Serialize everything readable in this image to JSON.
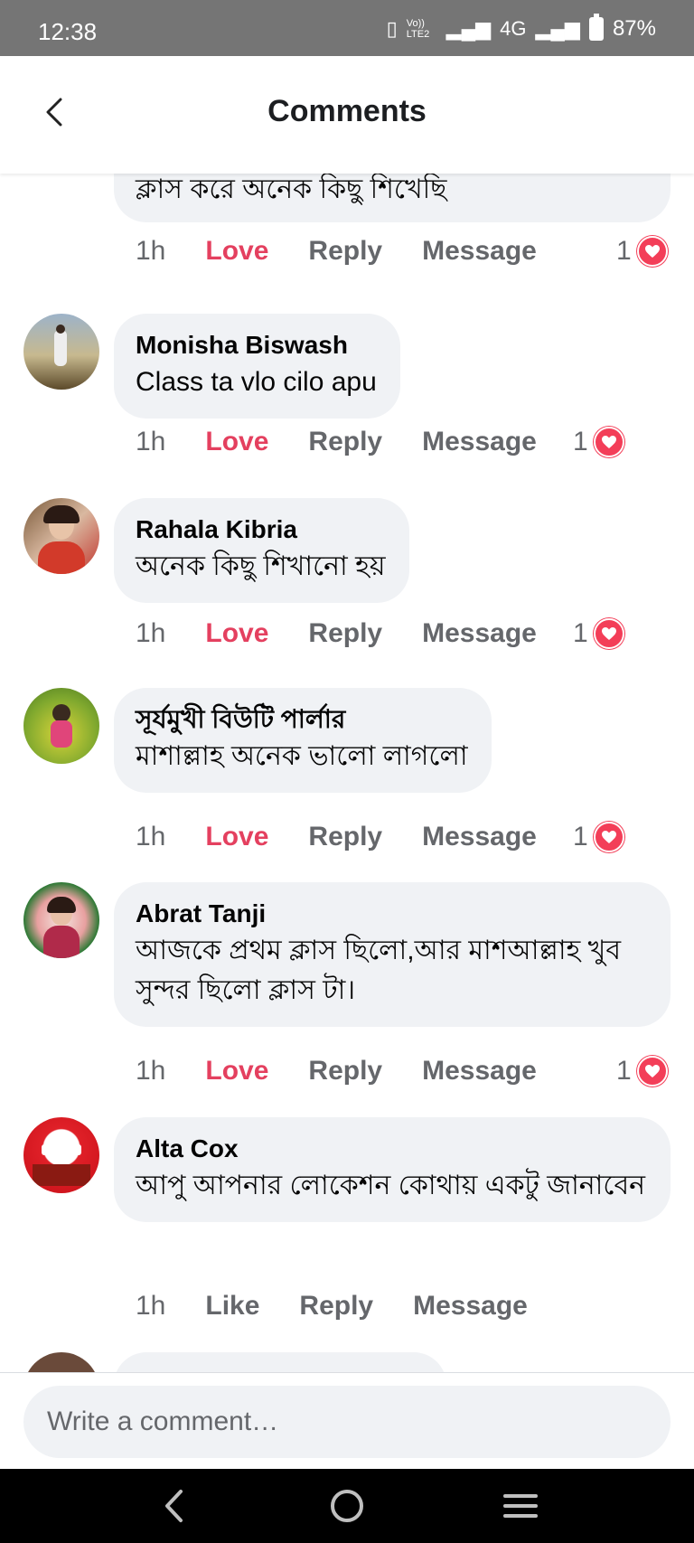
{
  "status": {
    "time": "12:38",
    "network_vol": "Vo)) LTE2",
    "network_type": "4G",
    "battery": "87%"
  },
  "header": {
    "title": "Comments",
    "back_icon": "chevron-left-icon"
  },
  "partial_comment": {
    "text": "ক্লাস করে অনেক কিছু শিখেছি",
    "time": "1h",
    "like_label": "Love",
    "reply_label": "Reply",
    "message_label": "Message",
    "reaction_count": "1"
  },
  "comments": [
    {
      "name": "Monisha Biswash",
      "text": "Class ta vlo cilo apu",
      "time": "1h",
      "like_label": "Love",
      "reply_label": "Reply",
      "message_label": "Message",
      "reaction_count": "1"
    },
    {
      "name": "Rahala Kibria",
      "text": "অনেক কিছু শিখানো হয়",
      "time": "1h",
      "like_label": "Love",
      "reply_label": "Reply",
      "message_label": "Message",
      "reaction_count": "1"
    },
    {
      "name": "সূর্যমুখী বিউটি পার্লার",
      "text": "মাশাল্লাহ  অনেক ভালো লাগলো",
      "time": "1h",
      "like_label": "Love",
      "reply_label": "Reply",
      "message_label": "Message",
      "reaction_count": "1"
    },
    {
      "name": "Abrat Tanji",
      "text": "আজকে প্রথম ক্লাস ছিলো,আর মাশআল্লাহ খুব সুন্দর ছিলো ক্লাস টা।",
      "time": "1h",
      "like_label": "Love",
      "reply_label": "Reply",
      "message_label": "Message",
      "reaction_count": "1"
    },
    {
      "name": "Alta Cox",
      "text": "আপু আপনার লোকেশন কোথায় একটু জানাবেন",
      "time": "1h",
      "like_label": "Like",
      "reply_label": "Reply",
      "message_label": "Message",
      "reaction_count": ""
    }
  ],
  "composer": {
    "placeholder": "Write a comment…"
  },
  "colors": {
    "love": "#e4405f",
    "bubble": "#f0f2f5",
    "heart": "#f33e58"
  }
}
